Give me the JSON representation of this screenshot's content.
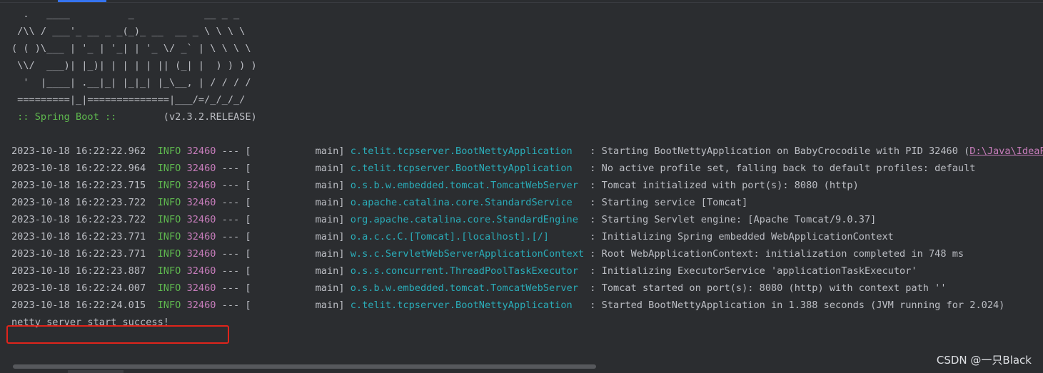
{
  "banner": {
    "lines": [
      "  .   ____          _            __ _ _",
      " /\\\\ / ___'_ __ _ _(_)_ __  __ _ \\ \\ \\ \\",
      "( ( )\\___ | '_ | '_| | '_ \\/ _` | \\ \\ \\ \\",
      " \\\\/  ___)| |_)| | | | | || (_| |  ) ) ) )",
      "  '  |____| .__|_| |_|_| |_\\__, | / / / /",
      " =========|_|==============|___/=/_/_/_/"
    ],
    "spring_label": " :: Spring Boot :: ",
    "version": "       (v2.3.2.RELEASE)"
  },
  "log_lines": [
    {
      "ts": "2023-10-18 16:22:22.962",
      "level": "INFO",
      "pid": "32460",
      "sep": " --- [",
      "thread": "           main]",
      "logger": "c.telit.tcpserver.BootNettyApplication  ",
      "msg": " : Starting BootNettyApplication on BabyCrocodile with PID 32460 (",
      "link": "D:\\Java\\IdeaProje"
    },
    {
      "ts": "2023-10-18 16:22:22.964",
      "level": "INFO",
      "pid": "32460",
      "sep": " --- [",
      "thread": "           main]",
      "logger": "c.telit.tcpserver.BootNettyApplication  ",
      "msg": " : No active profile set, falling back to default profiles: default"
    },
    {
      "ts": "2023-10-18 16:22:23.715",
      "level": "INFO",
      "pid": "32460",
      "sep": " --- [",
      "thread": "           main]",
      "logger": "o.s.b.w.embedded.tomcat.TomcatWebServer ",
      "msg": " : Tomcat initialized with port(s): 8080 (http)"
    },
    {
      "ts": "2023-10-18 16:22:23.722",
      "level": "INFO",
      "pid": "32460",
      "sep": " --- [",
      "thread": "           main]",
      "logger": "o.apache.catalina.core.StandardService  ",
      "msg": " : Starting service [Tomcat]"
    },
    {
      "ts": "2023-10-18 16:22:23.722",
      "level": "INFO",
      "pid": "32460",
      "sep": " --- [",
      "thread": "           main]",
      "logger": "org.apache.catalina.core.StandardEngine ",
      "msg": " : Starting Servlet engine: [Apache Tomcat/9.0.37]"
    },
    {
      "ts": "2023-10-18 16:22:23.771",
      "level": "INFO",
      "pid": "32460",
      "sep": " --- [",
      "thread": "           main]",
      "logger": "o.a.c.c.C.[Tomcat].[localhost].[/]      ",
      "msg": " : Initializing Spring embedded WebApplicationContext"
    },
    {
      "ts": "2023-10-18 16:22:23.771",
      "level": "INFO",
      "pid": "32460",
      "sep": " --- [",
      "thread": "           main]",
      "logger": "w.s.c.ServletWebServerApplicationContext",
      "msg": " : Root WebApplicationContext: initialization completed in 748 ms"
    },
    {
      "ts": "2023-10-18 16:22:23.887",
      "level": "INFO",
      "pid": "32460",
      "sep": " --- [",
      "thread": "           main]",
      "logger": "o.s.s.concurrent.ThreadPoolTaskExecutor ",
      "msg": " : Initializing ExecutorService 'applicationTaskExecutor'"
    },
    {
      "ts": "2023-10-18 16:22:24.007",
      "level": "INFO",
      "pid": "32460",
      "sep": " --- [",
      "thread": "           main]",
      "logger": "o.s.b.w.embedded.tomcat.TomcatWebServer ",
      "msg": " : Tomcat started on port(s): 8080 (http) with context path ''"
    },
    {
      "ts": "2023-10-18 16:22:24.015",
      "level": "INFO",
      "pid": "32460",
      "sep": " --- [",
      "thread": "           main]",
      "logger": "c.telit.tcpserver.BootNettyApplication  ",
      "msg": " : Started BootNettyApplication in 1.388 seconds (JVM running for 2.024)"
    }
  ],
  "final_line": "netty server start success!",
  "watermark": "CSDN @一只Black",
  "colors": {
    "background": "#2b2d30",
    "text": "#bcbec4",
    "info_level": "#5fb94f",
    "pid": "#c77dbb",
    "logger": "#2aacb8",
    "highlight_box": "#e0241b",
    "tab_indicator": "#3574f0"
  }
}
